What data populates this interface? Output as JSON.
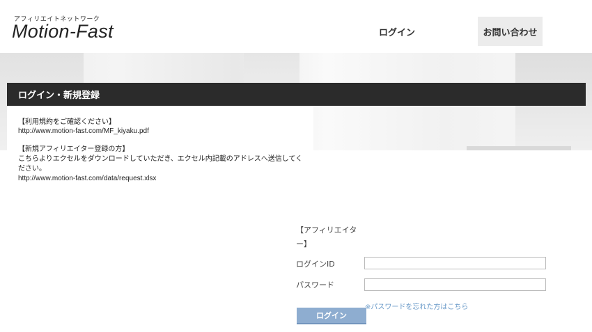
{
  "header": {
    "tagline": "アフィリエイトネットワーク",
    "logo": "Motion-Fast",
    "nav": {
      "login": "ログイン",
      "contact": "お問い合わせ"
    }
  },
  "section": {
    "title": "ログイン・新規登録"
  },
  "info": {
    "terms_heading": "【利用規約をご確認ください】",
    "terms_url": "http://www.motion-fast.com/MF_kiyaku.pdf",
    "new_heading": "【新規アフィリエイター登録の方】",
    "new_text_line1": "こちらよりエクセルをダウンロードしていただき、エクセル内記載のアドレスへ送信してく",
    "new_text_line2": "ださい。",
    "new_url": "http://www.motion-fast.com/data/request.xlsx"
  },
  "form": {
    "heading_line1": "【アフィリエイタ",
    "heading_line2": "ー】",
    "login_id_label": "ログインID",
    "login_id_value": "",
    "password_label": "パスワード",
    "password_value": "",
    "forgot_link": "※パスワードを忘れた方はこちら",
    "submit_label": "ログイン"
  },
  "colors": {
    "title_bar": "#2b2b2b",
    "button": "#8eadd0",
    "link": "#6b9bc9"
  }
}
